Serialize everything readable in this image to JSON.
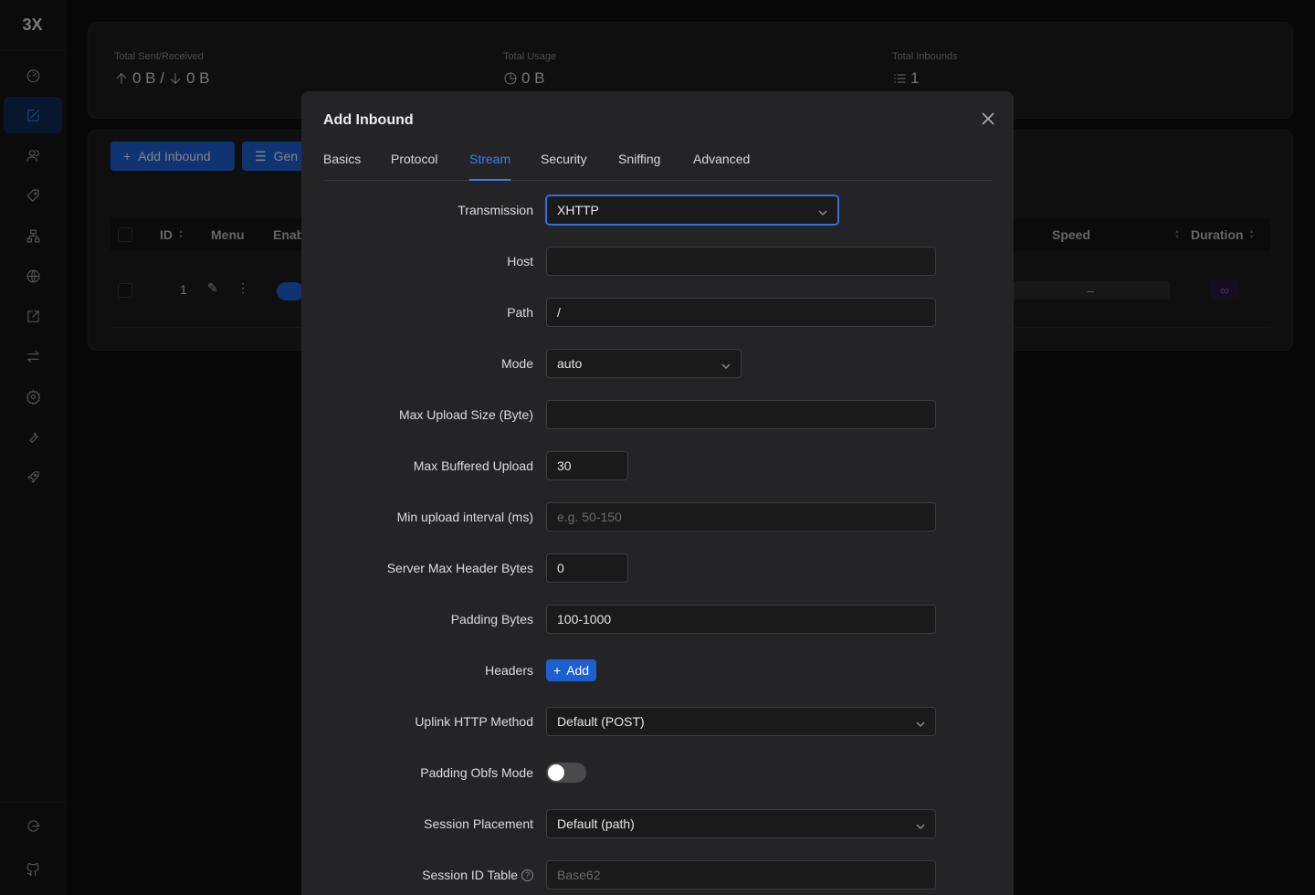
{
  "app": {
    "logo": "3X"
  },
  "sidebar": {
    "items": [
      {
        "icon": "dashboard-icon"
      },
      {
        "icon": "inbounds-edit-icon",
        "active": true
      },
      {
        "icon": "users-icon"
      },
      {
        "icon": "tag-icon"
      },
      {
        "icon": "network-icon"
      },
      {
        "icon": "globe-icon"
      },
      {
        "icon": "external-link-icon"
      },
      {
        "icon": "swap-icon"
      },
      {
        "icon": "settings-gear-icon"
      },
      {
        "icon": "wrench-icon"
      },
      {
        "icon": "rocket-icon"
      }
    ],
    "bottom": [
      {
        "icon": "logout-icon"
      },
      {
        "icon": "github-icon"
      }
    ]
  },
  "stats": {
    "sent_received_label": "Total Sent/Received",
    "sent_received_value": "0 B / 0 B",
    "sent_value": "0 B /",
    "received_value": "0 B",
    "usage_label": "Total Usage",
    "usage_value": "0 B",
    "inbounds_label": "Total Inbounds",
    "inbounds_value": "1"
  },
  "toolbar": {
    "add_inbound": "Add Inbound",
    "general": "Gen"
  },
  "table": {
    "headers": [
      "ID",
      "Menu",
      "Enab",
      "Speed",
      "Duration"
    ],
    "row": {
      "id": "1",
      "speed": "–",
      "duration": "∞"
    }
  },
  "modal": {
    "title": "Add Inbound",
    "tabs": [
      "Basics",
      "Protocol",
      "Stream",
      "Security",
      "Sniffing",
      "Advanced"
    ],
    "active_tab": "Stream",
    "fields": {
      "transmission": {
        "label": "Transmission",
        "value": "XHTTP"
      },
      "host": {
        "label": "Host",
        "value": ""
      },
      "path": {
        "label": "Path",
        "value": "/"
      },
      "mode": {
        "label": "Mode",
        "value": "auto"
      },
      "max_upload_size": {
        "label": "Max Upload Size (Byte)",
        "value": ""
      },
      "max_buffered_upload": {
        "label": "Max Buffered Upload",
        "value": "30"
      },
      "min_upload_interval": {
        "label": "Min upload interval (ms)",
        "placeholder": "e.g. 50-150"
      },
      "server_max_header_bytes": {
        "label": "Server Max Header Bytes",
        "value": "0"
      },
      "padding_bytes": {
        "label": "Padding Bytes",
        "value": "100-1000"
      },
      "headers": {
        "label": "Headers",
        "button": "Add"
      },
      "uplink_http_method": {
        "label": "Uplink HTTP Method",
        "value": "Default (POST)"
      },
      "padding_obfs_mode": {
        "label": "Padding Obfs Mode",
        "enabled": false
      },
      "session_placement": {
        "label": "Session Placement",
        "value": "Default (path)"
      },
      "session_id_table": {
        "label": "Session ID Table",
        "placeholder": "Base62"
      }
    }
  },
  "colors": {
    "accent": "#1d5fce",
    "active_tab": "#3b7de9",
    "modal_bg": "#242426"
  }
}
